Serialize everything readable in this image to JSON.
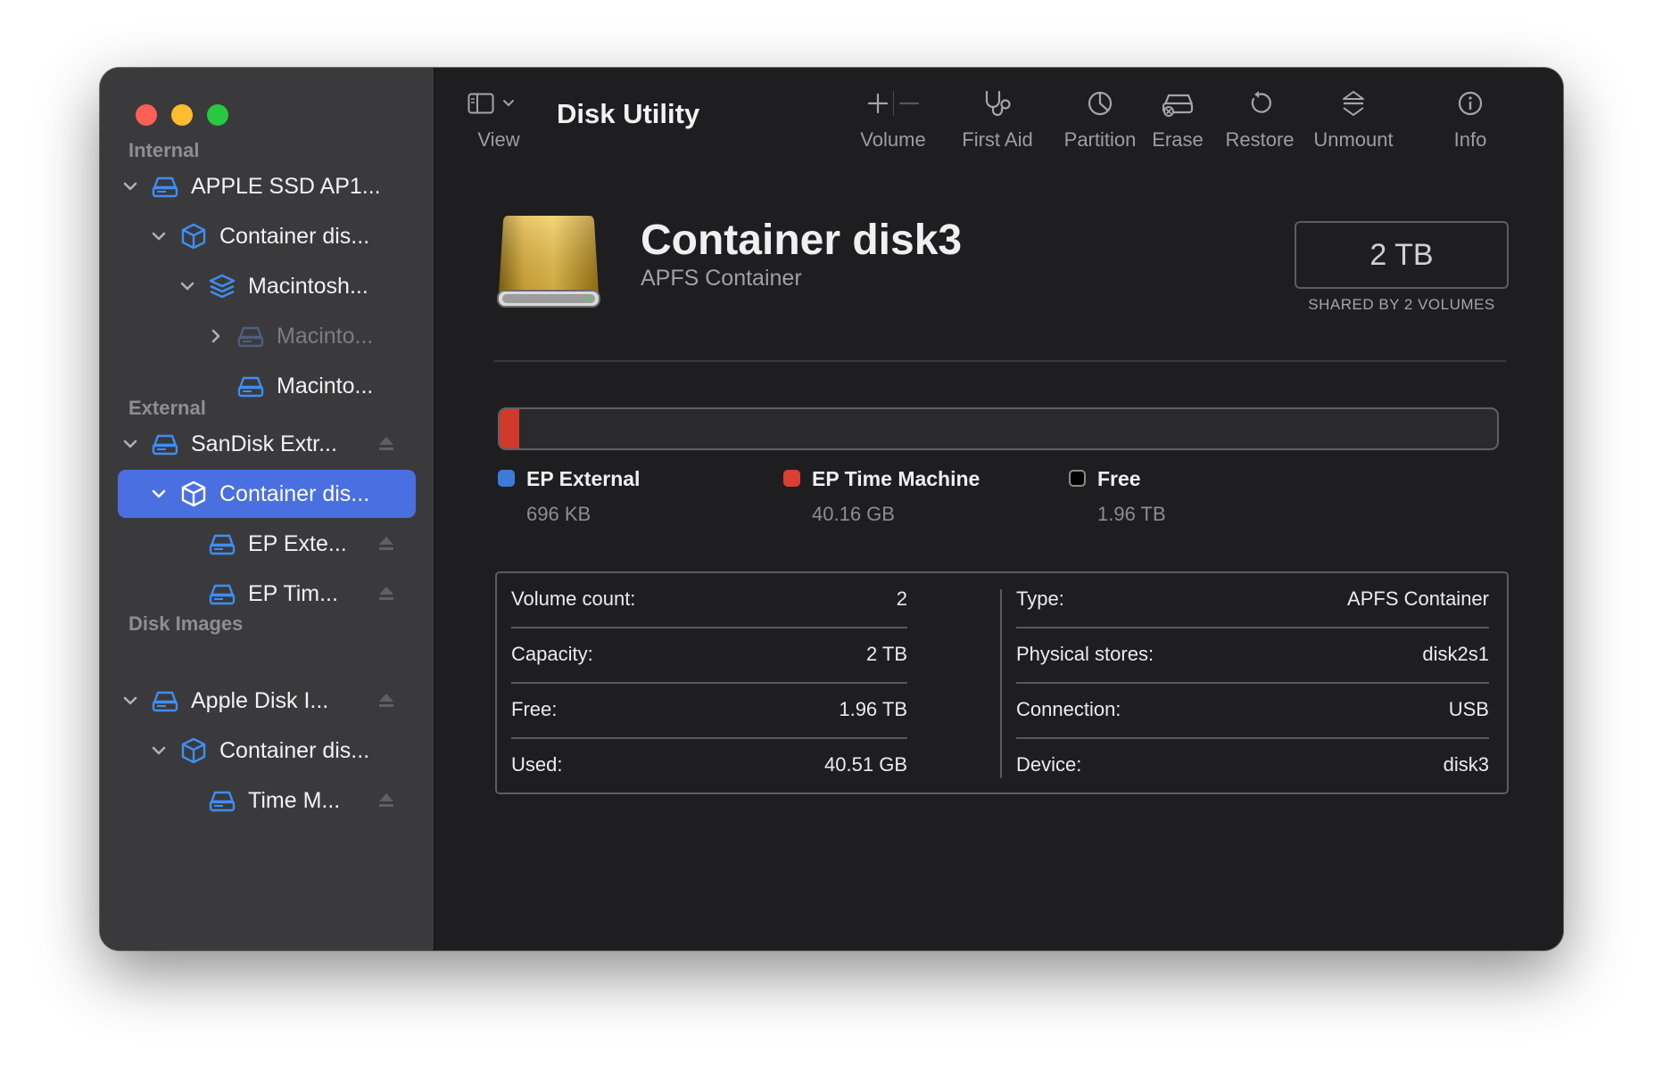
{
  "window": {
    "title": "Disk Utility"
  },
  "toolbar": {
    "view_label": "View",
    "volume_label": "Volume",
    "first_aid_label": "First Aid",
    "partition_label": "Partition",
    "erase_label": "Erase",
    "restore_label": "Restore",
    "unmount_label": "Unmount",
    "info_label": "Info"
  },
  "sidebar": {
    "sections": [
      {
        "title": "Internal"
      },
      {
        "title": "External"
      },
      {
        "title": "Disk Images"
      }
    ],
    "items": [
      {
        "label": "APPLE SSD AP1...",
        "icon": "drive-icon"
      },
      {
        "label": "Container dis...",
        "icon": "container-icon"
      },
      {
        "label": "Macintosh...",
        "icon": "volume-stack-icon"
      },
      {
        "label": "Macinto...",
        "icon": "drive-icon",
        "dimmed": true
      },
      {
        "label": "Macinto...",
        "icon": "drive-icon"
      },
      {
        "label": "SanDisk Extr...",
        "icon": "drive-icon"
      },
      {
        "label": "Container dis...",
        "icon": "container-icon",
        "selected": true
      },
      {
        "label": "EP Exte...",
        "icon": "drive-icon"
      },
      {
        "label": "EP Tim...",
        "icon": "drive-icon"
      },
      {
        "label": "Apple Disk I...",
        "icon": "drive-icon"
      },
      {
        "label": "Container dis...",
        "icon": "container-icon"
      },
      {
        "label": "Time M...",
        "icon": "drive-icon"
      }
    ]
  },
  "container": {
    "title": "Container disk3",
    "subtitle": "APFS Container",
    "capacity": "2 TB",
    "capacity_note": "SHARED BY 2 VOLUMES"
  },
  "usage": {
    "used_fraction": 0.0193,
    "legend": [
      {
        "name": "EP External",
        "value": "696 KB",
        "color": "#3d7bd9"
      },
      {
        "name": "EP Time Machine",
        "value": "40.16 GB",
        "color": "#d8412f"
      },
      {
        "name": "Free",
        "value": "1.96 TB",
        "color": "#000000"
      }
    ]
  },
  "info": {
    "left": [
      {
        "key": "Volume count:",
        "value": "2"
      },
      {
        "key": "Capacity:",
        "value": "2 TB"
      },
      {
        "key": "Free:",
        "value": "1.96 TB"
      },
      {
        "key": "Used:",
        "value": "40.51 GB"
      }
    ],
    "right": [
      {
        "key": "Type:",
        "value": "APFS Container"
      },
      {
        "key": "Physical stores:",
        "value": "disk2s1"
      },
      {
        "key": "Connection:",
        "value": "USB"
      },
      {
        "key": "Device:",
        "value": "disk3"
      }
    ]
  },
  "colors": {
    "accent": "#4a6fe0",
    "sidebar_icon": "#3e8ef7",
    "used_bar": "#cf3a2b"
  }
}
